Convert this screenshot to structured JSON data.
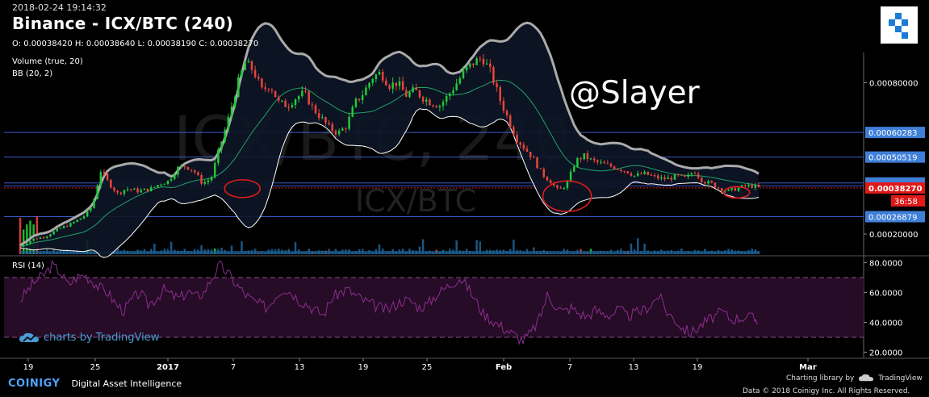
{
  "header": {
    "timestamp": "2018-02-24 19:14:32",
    "title": "Binance - ICX/BTC (240)",
    "ohlc": "O: 0.00038420 H: 0.00038640 L: 0.00038190 C: 0.00038270",
    "indicator_volume": "Volume (true, 20)",
    "indicator_bb": "BB (20, 2)",
    "rsi_label": "RSI (14)"
  },
  "watermark": {
    "symbol": "ICX/BTC",
    "pair_big": "ICX/BTC, 240",
    "annotation": "@Slayer"
  },
  "footer": {
    "tv_charts": "charts by TradingView",
    "coinigy_name": "COINIGY",
    "coinigy_tag": "Digital Asset Intelligence",
    "charting_library": "Charting library by",
    "tradingview": "TradingView",
    "copyright": "Data © 2018 Coinigy Inc. All Rights Reserved."
  },
  "colors": {
    "up": "#22c93a",
    "down": "#e8453c",
    "bb_band": "#ffffff",
    "bb_upper_highlight": "#aaaaaa",
    "bb_basis": "#1fa36b",
    "horizontal_line": "#3d5ccc",
    "price_label_bg": "#3f7fd8",
    "current_price": "#e01919",
    "rsi_line": "#8b2f8e",
    "rsi_band": "#2a0d2a",
    "volume": "#1b5f93",
    "circle": "#e11b1b"
  },
  "chart_data": [
    {
      "type": "candlestick",
      "title": "Binance - ICX/BTC (240)",
      "y_axis_ticks": [
        "0.00080000",
        "0.00020000"
      ],
      "ylim": [
        0.00012,
        0.00092
      ],
      "x_ticks": [
        "19",
        "25",
        "2017",
        "7",
        "13",
        "19",
        "25",
        "Feb",
        "7",
        "13",
        "19",
        "Mar"
      ],
      "horizontal_levels": [
        {
          "value": 0.00060283,
          "label": "0.00060283"
        },
        {
          "value": 0.00050519,
          "label": "0.00050519"
        },
        {
          "value": 0.0004024,
          "label": "0.00040240"
        },
        {
          "value": 0.00039111,
          "label": "0.00039111"
        },
        {
          "value": 0.00026879,
          "label": "0.00026879"
        }
      ],
      "current_price": {
        "value": 0.0003827,
        "label": "0.00038270",
        "countdown": "36:58"
      },
      "close_path": [
        [
          0,
          0.00015
        ],
        [
          15,
          0.00018
        ],
        [
          30,
          0.00019
        ],
        [
          45,
          0.00022
        ],
        [
          60,
          0.00024
        ],
        [
          75,
          0.00027
        ],
        [
          85,
          0.00031
        ],
        [
          95,
          0.00045
        ],
        [
          105,
          0.0004
        ],
        [
          115,
          0.00036
        ],
        [
          125,
          0.00038
        ],
        [
          140,
          0.00037
        ],
        [
          155,
          0.00038
        ],
        [
          165,
          0.0004
        ],
        [
          175,
          0.00041
        ],
        [
          185,
          0.00046
        ],
        [
          195,
          0.00047
        ],
        [
          205,
          0.00045
        ],
        [
          215,
          0.0004
        ],
        [
          225,
          0.00042
        ],
        [
          235,
          0.00054
        ],
        [
          245,
          0.00065
        ],
        [
          255,
          0.00078
        ],
        [
          265,
          0.00088
        ],
        [
          275,
          0.00085
        ],
        [
          285,
          0.00077
        ],
        [
          295,
          0.00079
        ],
        [
          305,
          0.00072
        ],
        [
          315,
          0.00071
        ],
        [
          325,
          0.00074
        ],
        [
          335,
          0.00076
        ],
        [
          345,
          0.0007
        ],
        [
          355,
          0.00066
        ],
        [
          365,
          0.00062
        ],
        [
          375,
          0.0006
        ],
        [
          385,
          0.00063
        ],
        [
          395,
          0.00072
        ],
        [
          405,
          0.00076
        ],
        [
          415,
          0.00082
        ],
        [
          425,
          0.00084
        ],
        [
          435,
          0.00079
        ],
        [
          445,
          0.0008
        ],
        [
          455,
          0.00075
        ],
        [
          465,
          0.00077
        ],
        [
          475,
          0.00074
        ],
        [
          485,
          0.00072
        ],
        [
          495,
          0.00071
        ],
        [
          505,
          0.00075
        ],
        [
          515,
          0.0008
        ],
        [
          525,
          0.00085
        ],
        [
          535,
          0.00088
        ],
        [
          545,
          0.0009
        ],
        [
          555,
          0.00084
        ],
        [
          565,
          0.00074
        ],
        [
          575,
          0.00066
        ],
        [
          585,
          0.00058
        ],
        [
          595,
          0.00054
        ],
        [
          605,
          0.0005
        ],
        [
          615,
          0.00044
        ],
        [
          625,
          0.00041
        ],
        [
          635,
          0.00037
        ],
        [
          645,
          0.0004
        ],
        [
          655,
          0.00049
        ],
        [
          665,
          0.00051
        ],
        [
          675,
          0.00049
        ],
        [
          685,
          0.00048
        ],
        [
          695,
          0.00047
        ],
        [
          705,
          0.00046
        ],
        [
          715,
          0.00045
        ],
        [
          725,
          0.00043
        ],
        [
          735,
          0.00044
        ],
        [
          745,
          0.00043
        ],
        [
          755,
          0.00042
        ],
        [
          765,
          0.00042
        ],
        [
          775,
          0.00043
        ],
        [
          785,
          0.00042
        ],
        [
          795,
          0.00045
        ],
        [
          805,
          0.00041
        ],
        [
          815,
          0.0004
        ],
        [
          825,
          0.00038
        ],
        [
          835,
          0.00037
        ],
        [
          845,
          0.00038
        ],
        [
          855,
          0.00039
        ],
        [
          865,
          0.00039
        ],
        [
          871,
          0.000383
        ]
      ]
    },
    {
      "type": "line",
      "title": "RSI (14)",
      "y_axis_ticks": [
        "80.0000",
        "60.0000",
        "40.0000",
        "20.0000"
      ],
      "ylim": [
        17,
        83
      ],
      "bands": [
        30,
        70
      ],
      "values": [
        [
          0,
          55
        ],
        [
          10,
          62
        ],
        [
          20,
          68
        ],
        [
          30,
          72
        ],
        [
          40,
          78
        ],
        [
          50,
          74
        ],
        [
          60,
          65
        ],
        [
          70,
          70
        ],
        [
          80,
          72
        ],
        [
          90,
          68
        ],
        [
          100,
          63
        ],
        [
          110,
          60
        ],
        [
          120,
          52
        ],
        [
          130,
          48
        ],
        [
          140,
          55
        ],
        [
          150,
          60
        ],
        [
          160,
          52
        ],
        [
          170,
          56
        ],
        [
          180,
          62
        ],
        [
          190,
          58
        ],
        [
          200,
          56
        ],
        [
          210,
          61
        ],
        [
          220,
          57
        ],
        [
          230,
          60
        ],
        [
          240,
          70
        ],
        [
          250,
          78
        ],
        [
          260,
          73
        ],
        [
          270,
          66
        ],
        [
          280,
          60
        ],
        [
          290,
          55
        ],
        [
          300,
          52
        ],
        [
          310,
          50
        ],
        [
          320,
          58
        ],
        [
          330,
          63
        ],
        [
          340,
          60
        ],
        [
          350,
          55
        ],
        [
          360,
          52
        ],
        [
          370,
          48
        ],
        [
          380,
          45
        ],
        [
          390,
          56
        ],
        [
          400,
          60
        ],
        [
          410,
          62
        ],
        [
          420,
          58
        ],
        [
          430,
          55
        ],
        [
          440,
          52
        ],
        [
          450,
          50
        ],
        [
          460,
          48
        ],
        [
          470,
          52
        ],
        [
          480,
          55
        ],
        [
          490,
          54
        ],
        [
          500,
          50
        ],
        [
          510,
          52
        ],
        [
          520,
          58
        ],
        [
          530,
          62
        ],
        [
          540,
          66
        ],
        [
          550,
          70
        ],
        [
          560,
          64
        ],
        [
          570,
          55
        ],
        [
          580,
          46
        ],
        [
          590,
          42
        ],
        [
          600,
          38
        ],
        [
          610,
          35
        ],
        [
          620,
          31
        ],
        [
          630,
          28
        ],
        [
          640,
          33
        ],
        [
          650,
          42
        ],
        [
          660,
          58
        ],
        [
          670,
          52
        ],
        [
          680,
          47
        ],
        [
          690,
          50
        ],
        [
          700,
          46
        ],
        [
          710,
          44
        ],
        [
          720,
          48
        ],
        [
          730,
          46
        ],
        [
          740,
          45
        ],
        [
          750,
          49
        ],
        [
          760,
          44
        ],
        [
          770,
          46
        ],
        [
          780,
          48
        ],
        [
          790,
          52
        ],
        [
          800,
          58
        ],
        [
          810,
          47
        ],
        [
          820,
          42
        ],
        [
          830,
          36
        ],
        [
          840,
          33
        ],
        [
          850,
          37
        ],
        [
          860,
          41
        ],
        [
          870,
          44
        ],
        [
          880,
          47
        ],
        [
          890,
          42
        ],
        [
          900,
          43
        ],
        [
          910,
          44
        ],
        [
          920,
          42
        ],
        [
          925,
          42
        ]
      ]
    }
  ]
}
